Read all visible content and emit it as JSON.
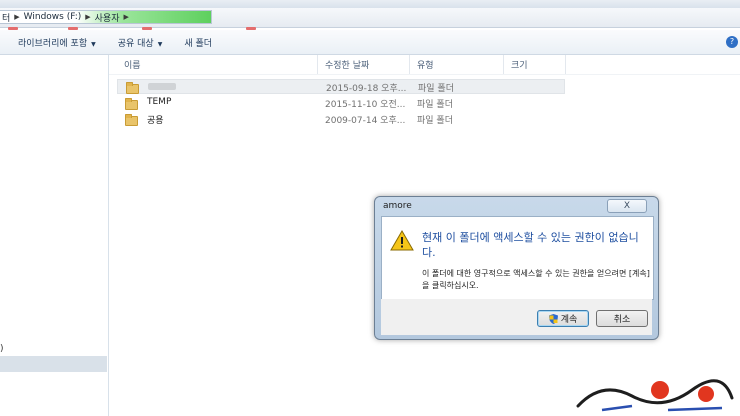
{
  "address_bar": {
    "crumbs": [
      "터",
      "Windows (F:)",
      "사용자"
    ]
  },
  "toolbar": {
    "items": [
      {
        "label": "라이브러리에 포함",
        "has_dropdown": true
      },
      {
        "label": "공유 대상",
        "has_dropdown": true
      },
      {
        "label": "새 폴더",
        "has_dropdown": false
      }
    ]
  },
  "nav_pane": {
    "partial_text": ")"
  },
  "file_list": {
    "columns": [
      "이름",
      "수정한 날짜",
      "유형",
      "크기"
    ],
    "rows": [
      {
        "name": "",
        "blurred": true,
        "date": "2015-09-18 오후...",
        "type": "파일 폴더"
      },
      {
        "name": "TEMP",
        "blurred": false,
        "date": "2015-11-10 오전...",
        "type": "파일 폴더"
      },
      {
        "name": "공용",
        "blurred": false,
        "date": "2009-07-14 오후...",
        "type": "파일 폴더"
      }
    ]
  },
  "dialog": {
    "title": "amore",
    "close_label": "X",
    "main_instruction": "현재 이 폴더에 액세스할 수 있는 권한이 없습니다.",
    "detail": "이 폴더에 대한 영구적으로 액세스할 수 있는 권한을 얻으려면 [계속]을 클릭하십시오.",
    "continue_label": "계속",
    "cancel_label": "취소",
    "icons": {
      "warning": "warning-icon",
      "shield": "uac-shield-icon"
    }
  },
  "colors": {
    "accent_text": "#1f4fa0",
    "selection": "#eceff2",
    "folder": "#e9c46a"
  }
}
